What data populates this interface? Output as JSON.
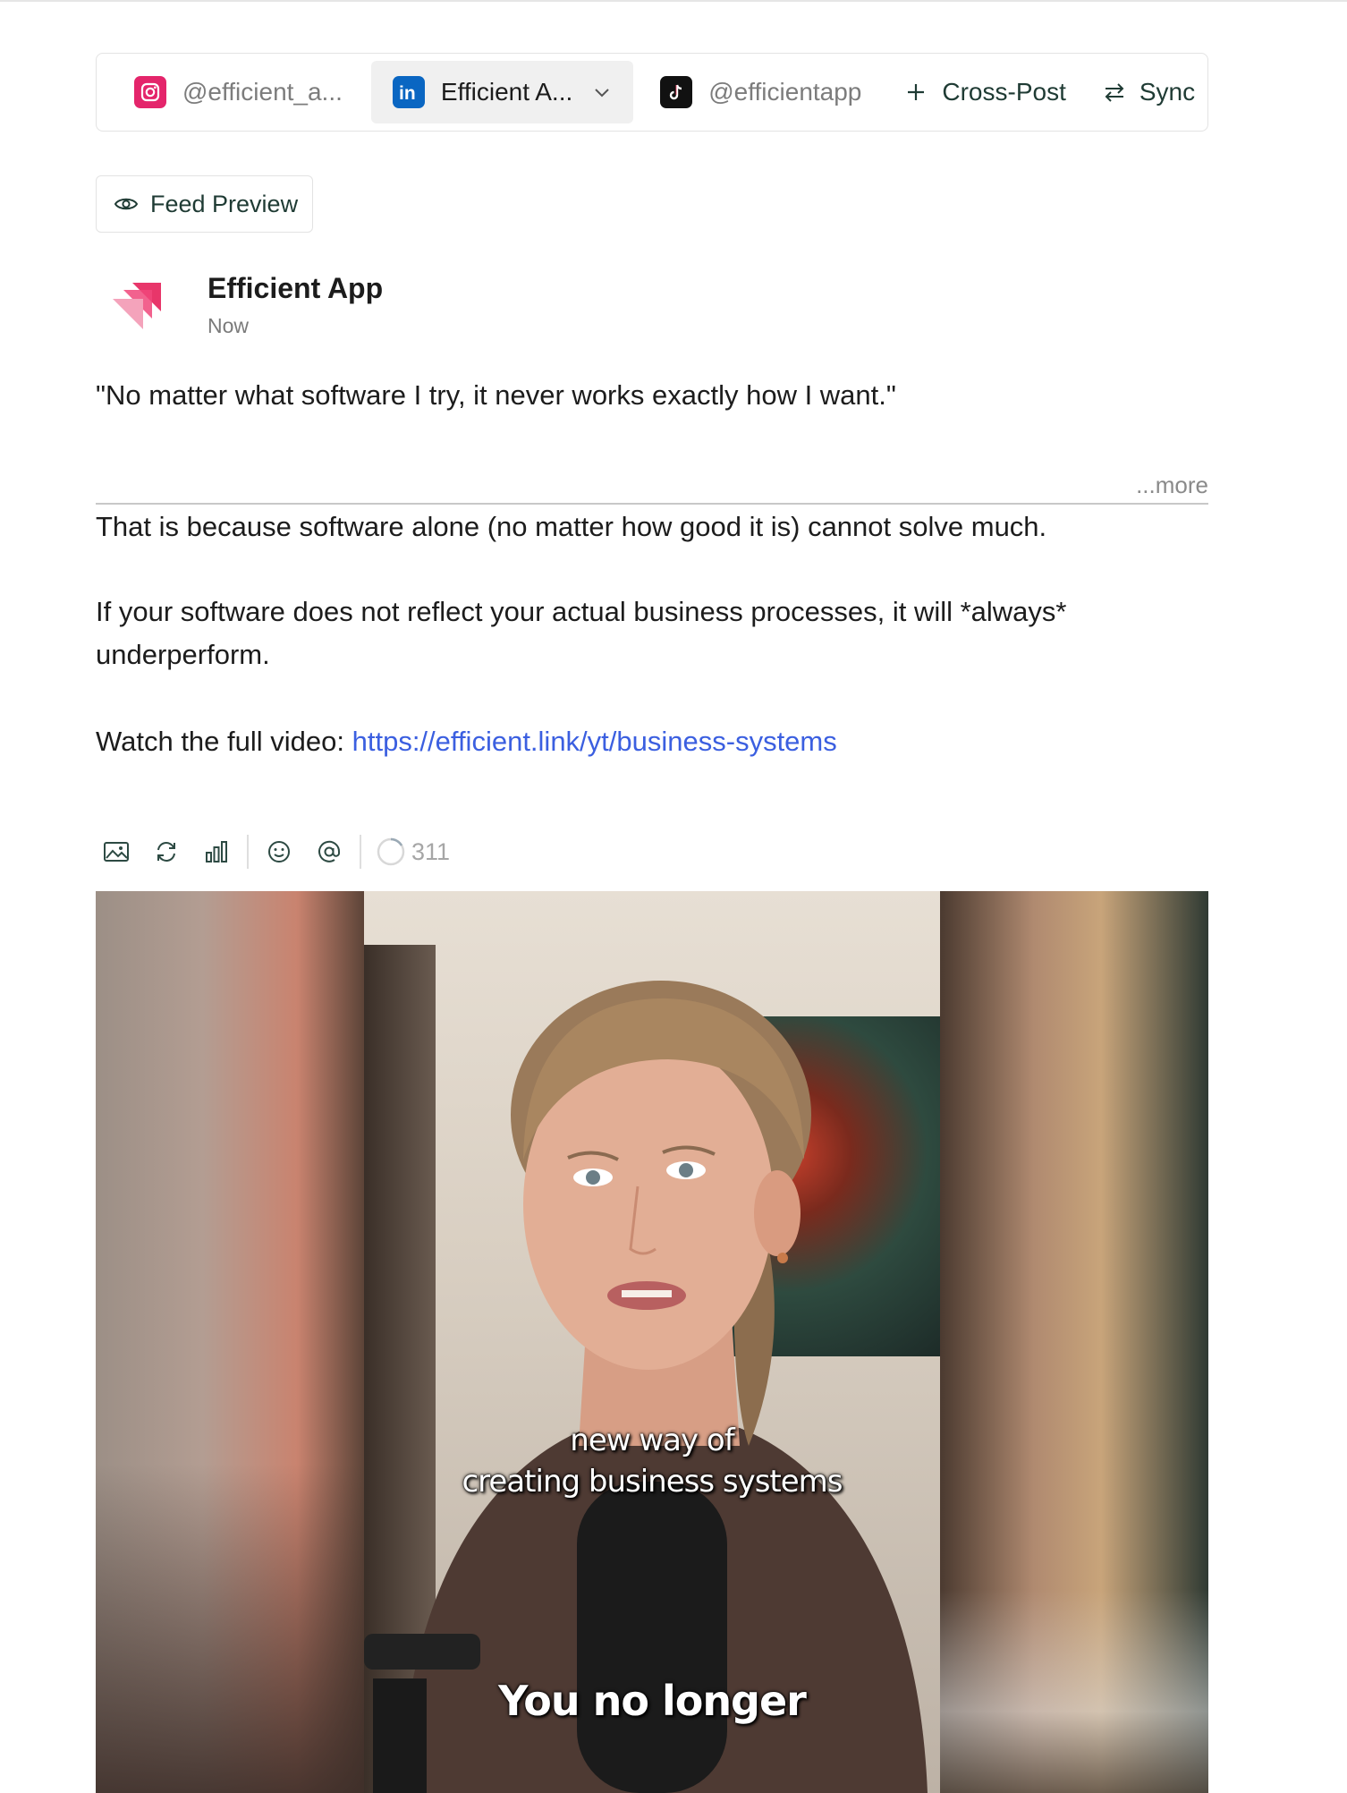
{
  "accounts": [
    {
      "platform": "instagram",
      "handle": "@efficient_a...",
      "icon": "instagram-icon",
      "color": "#e4256b"
    },
    {
      "platform": "linkedin",
      "handle": "Efficient A...",
      "icon": "linkedin-icon",
      "color": "#0a66c2",
      "selected": true
    },
    {
      "platform": "tiktok",
      "handle": "@efficientapp",
      "icon": "tiktok-icon",
      "color": "#111111"
    }
  ],
  "actions": {
    "cross_post": "Cross-Post",
    "sync": "Sync"
  },
  "feed_preview": {
    "label": "Feed Preview"
  },
  "post": {
    "author": "Efficient App",
    "time": "Now",
    "quote": "\"No matter what software I try, it never works exactly how I want.\"",
    "more": "...more",
    "p1": "That is because software alone (no matter how good it is) cannot solve much.",
    "p2": "If your software does not reflect your actual business processes, it will *always* underperform.",
    "p3_prefix": "Watch the full video: ",
    "p3_link": "https://efficient.link/yt/business-systems"
  },
  "toolbar": {
    "icons": [
      "image-icon",
      "repost-icon",
      "chart-icon",
      "emoji-icon",
      "mention-icon"
    ],
    "char_count": "311"
  },
  "media": {
    "caption_line1": "new way of",
    "caption_line2": "creating business systems",
    "caption_big": "You no longer"
  },
  "colors": {
    "accent": "#1f3b34",
    "link": "#3b5fe0",
    "brand_pink": "#f0477a"
  }
}
